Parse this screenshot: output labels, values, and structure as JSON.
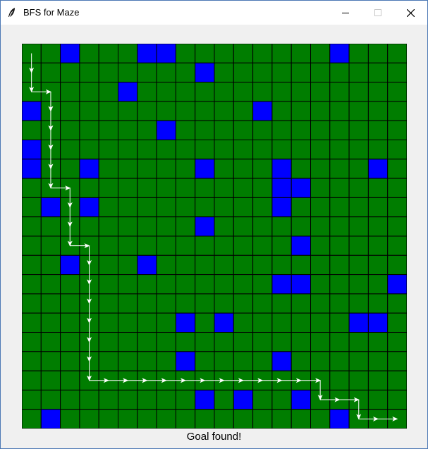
{
  "window": {
    "title": "BFS for Maze"
  },
  "maze": {
    "rows": 20,
    "cols": 20,
    "colors": {
      "open": "#007d00",
      "wall": "#0000ff",
      "grid_line": "#000000",
      "path": "#ffffff"
    },
    "walls": [
      [
        0,
        2
      ],
      [
        0,
        6
      ],
      [
        0,
        7
      ],
      [
        0,
        16
      ],
      [
        1,
        9
      ],
      [
        2,
        5
      ],
      [
        3,
        0
      ],
      [
        3,
        12
      ],
      [
        4,
        7
      ],
      [
        5,
        0
      ],
      [
        6,
        0
      ],
      [
        6,
        3
      ],
      [
        6,
        9
      ],
      [
        6,
        13
      ],
      [
        6,
        18
      ],
      [
        7,
        13
      ],
      [
        7,
        14
      ],
      [
        8,
        1
      ],
      [
        8,
        3
      ],
      [
        8,
        13
      ],
      [
        9,
        9
      ],
      [
        10,
        14
      ],
      [
        11,
        2
      ],
      [
        11,
        6
      ],
      [
        12,
        13
      ],
      [
        12,
        14
      ],
      [
        12,
        19
      ],
      [
        14,
        8
      ],
      [
        14,
        10
      ],
      [
        14,
        17
      ],
      [
        14,
        18
      ],
      [
        16,
        8
      ],
      [
        16,
        13
      ],
      [
        18,
        9
      ],
      [
        18,
        11
      ],
      [
        18,
        14
      ],
      [
        19,
        1
      ],
      [
        19,
        16
      ]
    ],
    "path": [
      [
        0,
        0
      ],
      [
        1,
        0
      ],
      [
        2,
        0
      ],
      [
        2,
        1
      ],
      [
        3,
        1
      ],
      [
        4,
        1
      ],
      [
        5,
        1
      ],
      [
        6,
        1
      ],
      [
        7,
        1
      ],
      [
        7,
        2
      ],
      [
        8,
        2
      ],
      [
        9,
        2
      ],
      [
        10,
        2
      ],
      [
        10,
        3
      ],
      [
        11,
        3
      ],
      [
        12,
        3
      ],
      [
        13,
        3
      ],
      [
        14,
        3
      ],
      [
        15,
        3
      ],
      [
        16,
        3
      ],
      [
        17,
        3
      ],
      [
        17,
        4
      ],
      [
        17,
        5
      ],
      [
        17,
        6
      ],
      [
        17,
        7
      ],
      [
        17,
        8
      ],
      [
        17,
        9
      ],
      [
        17,
        10
      ],
      [
        17,
        11
      ],
      [
        17,
        12
      ],
      [
        17,
        13
      ],
      [
        17,
        14
      ],
      [
        17,
        15
      ],
      [
        18,
        15
      ],
      [
        18,
        16
      ],
      [
        18,
        17
      ],
      [
        19,
        17
      ],
      [
        19,
        18
      ],
      [
        19,
        19
      ]
    ]
  },
  "status": {
    "text": "Goal found!"
  }
}
